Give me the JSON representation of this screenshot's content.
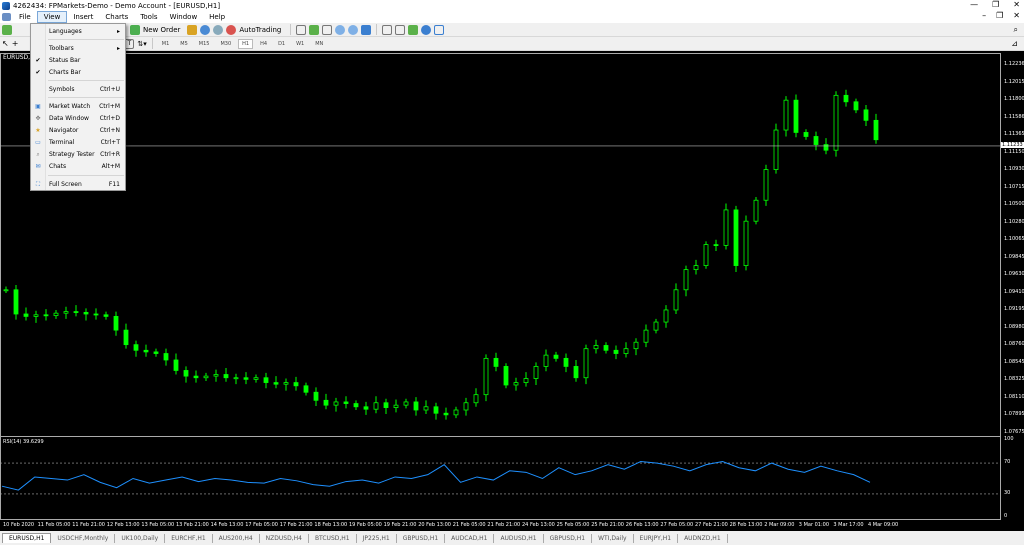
{
  "window": {
    "title": "4262434: FPMarkets-Demo - Demo Account - [EURUSD,H1]",
    "min": "—",
    "max": "❐",
    "close": "✕"
  },
  "menubar": {
    "items": [
      "File",
      "View",
      "Insert",
      "Charts",
      "Tools",
      "Window",
      "Help"
    ],
    "right": [
      "–",
      "❐",
      "✕"
    ]
  },
  "toolbar": {
    "new_order": "New Order",
    "autotrading": "AutoTrading",
    "timeframes": [
      "M1",
      "M5",
      "M15",
      "M30",
      "H1",
      "H4",
      "D1",
      "W1",
      "MN"
    ],
    "selected_timeframe": "H1"
  },
  "view_menu": {
    "items": [
      {
        "label": "Languages",
        "shortcut": "",
        "submenu": true,
        "icon": ""
      },
      {
        "label": "Toolbars",
        "shortcut": "",
        "submenu": true,
        "icon": ""
      },
      {
        "label": "Status Bar",
        "shortcut": "",
        "checked": true,
        "icon": ""
      },
      {
        "label": "Charts Bar",
        "shortcut": "",
        "checked": true,
        "icon": ""
      },
      {
        "label": "Symbols",
        "shortcut": "Ctrl+U",
        "icon": ""
      },
      {
        "label": "Market Watch",
        "shortcut": "Ctrl+M",
        "icon": "market-watch-icon"
      },
      {
        "label": "Data Window",
        "shortcut": "Ctrl+D",
        "icon": "data-window-icon"
      },
      {
        "label": "Navigator",
        "shortcut": "Ctrl+N",
        "icon": "navigator-icon"
      },
      {
        "label": "Terminal",
        "shortcut": "Ctrl+T",
        "icon": "terminal-icon"
      },
      {
        "label": "Strategy Tester",
        "shortcut": "Ctrl+R",
        "icon": "strategy-tester-icon"
      },
      {
        "label": "Chats",
        "shortcut": "Alt+M",
        "icon": "chats-icon"
      },
      {
        "label": "Full Screen",
        "shortcut": "F11",
        "icon": "full-screen-icon"
      }
    ]
  },
  "chart_data": {
    "type": "line",
    "symbol_label": "EURUSD,H1",
    "current_price": "1.11233",
    "y_ticks": [
      "1.12236",
      "1.12015",
      "1.11800",
      "1.11586",
      "1.11365",
      "1.11150",
      "1.10930",
      "1.10715",
      "1.10500",
      "1.10280",
      "1.10065",
      "1.09845",
      "1.09630",
      "1.09410",
      "1.09195",
      "1.08980",
      "1.08760",
      "1.08545",
      "1.08325",
      "1.08110",
      "1.07895",
      "1.07675"
    ],
    "ylim": [
      1.07675,
      1.12236
    ],
    "x_ticks": [
      "10 Feb 2020",
      "11 Feb 05:00",
      "11 Feb 21:00",
      "12 Feb 13:00",
      "13 Feb 05:00",
      "13 Feb 21:00",
      "14 Feb 13:00",
      "17 Feb 05:00",
      "17 Feb 21:00",
      "18 Feb 13:00",
      "19 Feb 05:00",
      "19 Feb 21:00",
      "20 Feb 13:00",
      "21 Feb 05:00",
      "21 Feb 21:00",
      "24 Feb 13:00",
      "25 Feb 05:00",
      "25 Feb 21:00",
      "26 Feb 13:00",
      "27 Feb 05:00",
      "27 Feb 21:00",
      "28 Feb 13:00",
      "2 Mar 09:00",
      "3 Mar 01:00",
      "3 Mar 17:00",
      "4 Mar 09:00"
    ],
    "closes": [
      1.0945,
      1.0915,
      1.0912,
      1.0914,
      1.0913,
      1.0916,
      1.0918,
      1.0917,
      1.0915,
      1.0914,
      1.0912,
      1.0895,
      1.0877,
      1.087,
      1.0868,
      1.0866,
      1.0858,
      1.0845,
      1.0838,
      1.0836,
      1.0838,
      1.084,
      1.0836,
      1.0836,
      1.0834,
      1.0836,
      1.083,
      1.0828,
      1.083,
      1.0826,
      1.0818,
      1.0808,
      1.0802,
      1.0806,
      1.0804,
      1.08,
      1.0797,
      1.0805,
      1.0799,
      1.0802,
      1.0806,
      1.0796,
      1.08,
      1.0792,
      1.079,
      1.0796,
      1.0805,
      1.0815,
      1.086,
      1.085,
      1.0827,
      1.083,
      1.0835,
      1.085,
      1.0864,
      1.086,
      1.085,
      1.0836,
      1.0872,
      1.0876,
      1.087,
      1.0866,
      1.0872,
      1.088,
      1.0895,
      1.0905,
      1.092,
      1.0945,
      1.097,
      1.0975,
      1.1001,
      1.1,
      1.1044,
      1.0975,
      1.103,
      1.1056,
      1.1094,
      1.1143,
      1.118,
      1.114,
      1.1135,
      1.1125,
      1.1118,
      1.1186,
      1.1178,
      1.1168,
      1.1155,
      1.1131
    ],
    "rsi": {
      "label": "RSI(14) 39.6299",
      "levels": [
        70,
        30
      ],
      "ticks": [
        "100",
        "70",
        "30",
        "0"
      ],
      "values": [
        40,
        35,
        52,
        50,
        48,
        55,
        45,
        38,
        50,
        44,
        48,
        52,
        46,
        50,
        48,
        45,
        44,
        50,
        47,
        42,
        40,
        46,
        48,
        44,
        52,
        50,
        55,
        68,
        45,
        52,
        48,
        60,
        58,
        50,
        64,
        55,
        60,
        68,
        62,
        72,
        70,
        66,
        60,
        68,
        72,
        64,
        60,
        70,
        62,
        58,
        66,
        60,
        55,
        45
      ]
    }
  },
  "tabs": {
    "items": [
      "EURUSD,H1",
      "USDCHF,Monthly",
      "UK100,Daily",
      "EURCHF,H1",
      "AUS200,H4",
      "NZDUSD,H4",
      "BTCUSD,H1",
      "JP225,H1",
      "GBPUSD,H1",
      "AUDCAD,H1",
      "AUDUSD,H1",
      "GBPUSD,H1",
      "WTI,Daily",
      "EURJPY,H1",
      "AUDNZD,H1"
    ],
    "active": 0
  }
}
